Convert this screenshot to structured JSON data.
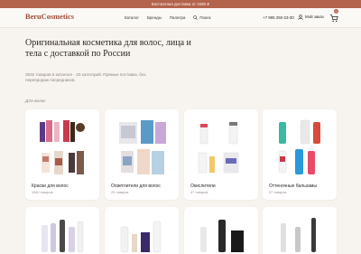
{
  "promo": {
    "text": "Бесплатная доставка от 3490 ₽"
  },
  "header": {
    "logo": "BeruCosmetics",
    "nav": [
      "Каталог",
      "Бренды",
      "Палитра"
    ],
    "search_label": "Поиск",
    "phone": "+7 995 250-23-30",
    "account_label": "Мой заказ",
    "cart_count": "0",
    "icons": {
      "search": "search-icon",
      "account": "user-icon",
      "cart": "cart-icon"
    }
  },
  "hero": {
    "title": "Оригинальная косметика для волос, лица и тела с доставкой по России",
    "subtitle": "2932 товаров в каталоге · 20 категорий. Прямые поставки, без перепродаж посредников."
  },
  "section": {
    "label": "Для волос"
  },
  "categories": [
    {
      "title": "Краски для волос",
      "count": "1060 товаров"
    },
    {
      "title": "Осветлители для волос",
      "count": "29 товаров"
    },
    {
      "title": "Окислители",
      "count": "47 товаров"
    },
    {
      "title": "Оттеночные бальзамы",
      "count": "57 товаров"
    },
    {
      "title": "",
      "count": ""
    },
    {
      "title": "",
      "count": ""
    },
    {
      "title": "",
      "count": ""
    },
    {
      "title": "",
      "count": ""
    }
  ],
  "colors": {
    "accent": "#b4634c",
    "logo": "#a24a36",
    "background": "#f7f3ee"
  }
}
